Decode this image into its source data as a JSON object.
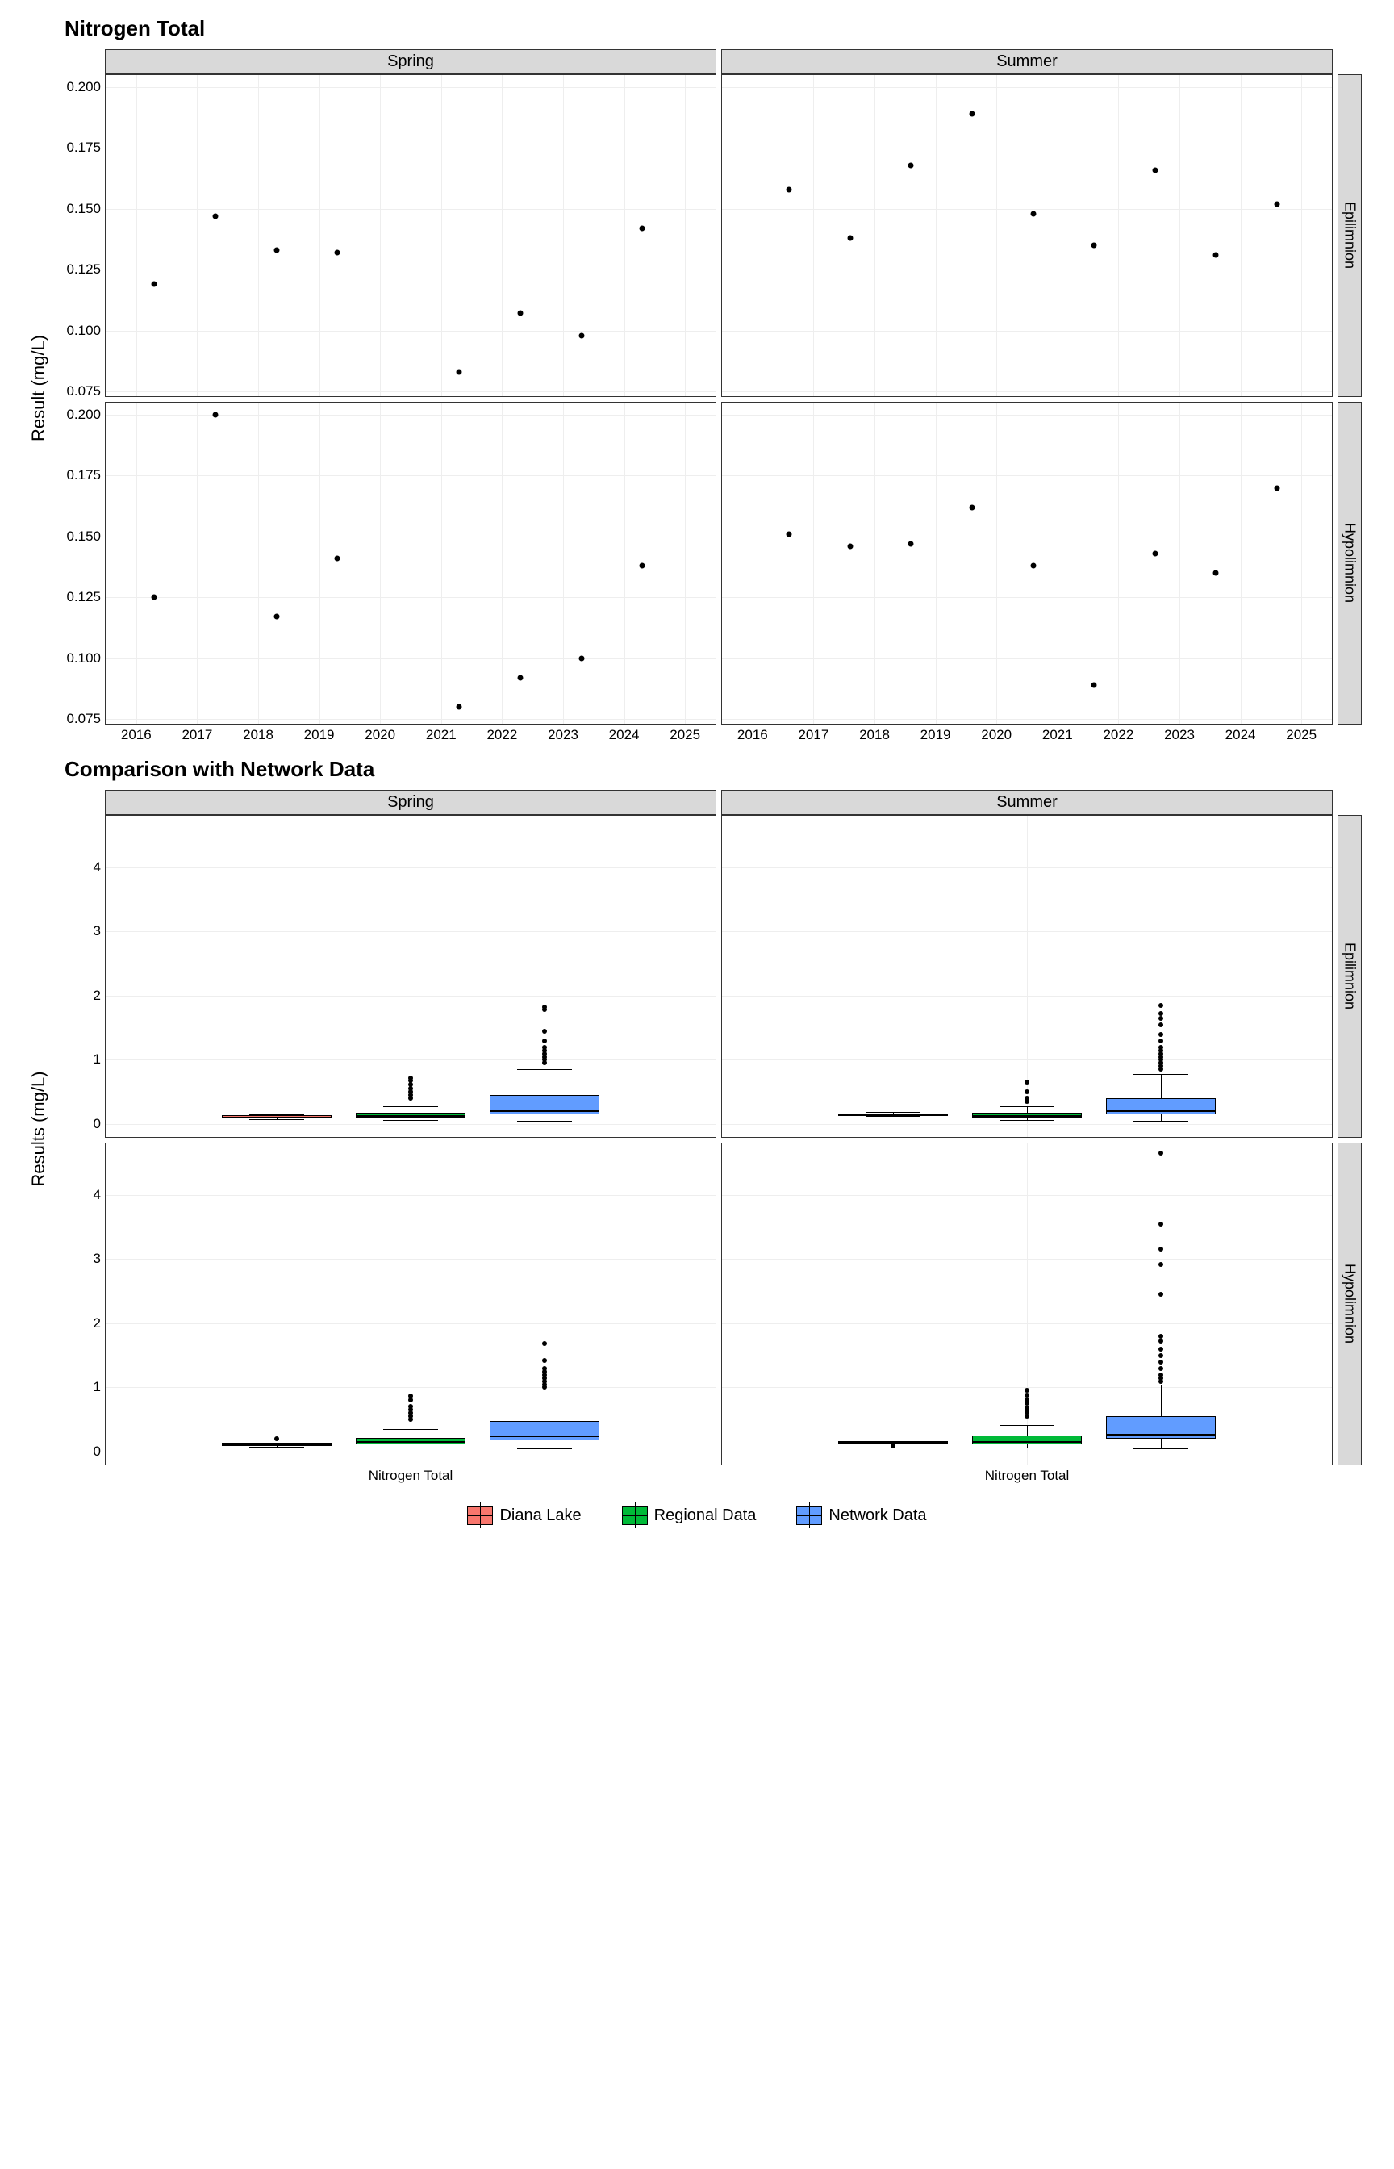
{
  "chart_data": [
    {
      "title": "Nitrogen Total",
      "type": "scatter",
      "ylabel": "Result (mg/L)",
      "xlabel": "",
      "col_facets": [
        "Spring",
        "Summer"
      ],
      "row_facets": [
        "Epilimnion",
        "Hypolimnion"
      ],
      "xlim": [
        2015.5,
        2025.5
      ],
      "ylim": [
        0.073,
        0.205
      ],
      "xticks": [
        2016,
        2017,
        2018,
        2019,
        2020,
        2021,
        2022,
        2023,
        2024,
        2025
      ],
      "yticks": [
        0.075,
        0.1,
        0.125,
        0.15,
        0.175,
        0.2
      ],
      "ytick_labels": [
        "0.075",
        "0.100",
        "0.125",
        "0.150",
        "0.175",
        "0.200"
      ],
      "panels": {
        "Spring|Epilimnion": [
          {
            "x": 2016.3,
            "y": 0.119
          },
          {
            "x": 2017.3,
            "y": 0.147
          },
          {
            "x": 2018.3,
            "y": 0.133
          },
          {
            "x": 2019.3,
            "y": 0.132
          },
          {
            "x": 2021.3,
            "y": 0.083
          },
          {
            "x": 2022.3,
            "y": 0.107
          },
          {
            "x": 2023.3,
            "y": 0.098
          },
          {
            "x": 2024.3,
            "y": 0.142
          }
        ],
        "Summer|Epilimnion": [
          {
            "x": 2016.6,
            "y": 0.158
          },
          {
            "x": 2017.6,
            "y": 0.138
          },
          {
            "x": 2018.6,
            "y": 0.168
          },
          {
            "x": 2019.6,
            "y": 0.189
          },
          {
            "x": 2020.6,
            "y": 0.148
          },
          {
            "x": 2021.6,
            "y": 0.135
          },
          {
            "x": 2022.6,
            "y": 0.166
          },
          {
            "x": 2023.6,
            "y": 0.131
          },
          {
            "x": 2024.6,
            "y": 0.152
          }
        ],
        "Spring|Hypolimnion": [
          {
            "x": 2016.3,
            "y": 0.125
          },
          {
            "x": 2017.3,
            "y": 0.2
          },
          {
            "x": 2018.3,
            "y": 0.117
          },
          {
            "x": 2019.3,
            "y": 0.141
          },
          {
            "x": 2021.3,
            "y": 0.08
          },
          {
            "x": 2022.3,
            "y": 0.092
          },
          {
            "x": 2023.3,
            "y": 0.1
          },
          {
            "x": 2024.3,
            "y": 0.138
          }
        ],
        "Summer|Hypolimnion": [
          {
            "x": 2016.6,
            "y": 0.151
          },
          {
            "x": 2017.6,
            "y": 0.146
          },
          {
            "x": 2018.6,
            "y": 0.147
          },
          {
            "x": 2019.6,
            "y": 0.162
          },
          {
            "x": 2020.6,
            "y": 0.138
          },
          {
            "x": 2021.6,
            "y": 0.089
          },
          {
            "x": 2022.6,
            "y": 0.143
          },
          {
            "x": 2023.6,
            "y": 0.135
          },
          {
            "x": 2024.6,
            "y": 0.17
          }
        ]
      }
    },
    {
      "title": "Comparison with Network Data",
      "type": "boxplot",
      "ylabel": "Results (mg/L)",
      "xlabel_cat": "Nitrogen Total",
      "col_facets": [
        "Spring",
        "Summer"
      ],
      "row_facets": [
        "Epilimnion",
        "Hypolimnion"
      ],
      "ylim": [
        -0.2,
        4.8
      ],
      "yticks": [
        0,
        1,
        2,
        3,
        4
      ],
      "series": [
        "Diana Lake",
        "Regional Data",
        "Network Data"
      ],
      "colors": {
        "Diana Lake": "#F8766D",
        "Regional Data": "#00BA38",
        "Network Data": "#619CFF"
      },
      "panels": {
        "Spring|Epilimnion": {
          "Diana Lake": {
            "min": 0.08,
            "q1": 0.1,
            "med": 0.12,
            "q3": 0.14,
            "max": 0.15,
            "outliers": []
          },
          "Regional Data": {
            "min": 0.06,
            "q1": 0.1,
            "med": 0.14,
            "q3": 0.18,
            "max": 0.28,
            "outliers": [
              0.4,
              0.45,
              0.5,
              0.55,
              0.62,
              0.68,
              0.72
            ]
          },
          "Network Data": {
            "min": 0.05,
            "q1": 0.15,
            "med": 0.22,
            "q3": 0.45,
            "max": 0.85,
            "outliers": [
              0.95,
              1.0,
              1.05,
              1.1,
              1.15,
              1.2,
              1.3,
              1.45,
              1.78,
              1.82
            ]
          }
        },
        "Summer|Epilimnion": {
          "Diana Lake": {
            "min": 0.13,
            "q1": 0.14,
            "med": 0.15,
            "q3": 0.17,
            "max": 0.19,
            "outliers": []
          },
          "Regional Data": {
            "min": 0.06,
            "q1": 0.1,
            "med": 0.14,
            "q3": 0.18,
            "max": 0.28,
            "outliers": [
              0.35,
              0.4,
              0.5,
              0.65
            ]
          },
          "Network Data": {
            "min": 0.05,
            "q1": 0.15,
            "med": 0.22,
            "q3": 0.4,
            "max": 0.78,
            "outliers": [
              0.85,
              0.9,
              0.95,
              1.0,
              1.05,
              1.1,
              1.15,
              1.2,
              1.3,
              1.4,
              1.55,
              1.65,
              1.72,
              1.85
            ]
          }
        },
        "Spring|Hypolimnion": {
          "Diana Lake": {
            "min": 0.08,
            "q1": 0.1,
            "med": 0.12,
            "q3": 0.14,
            "max": 0.14,
            "outliers": [
              0.2
            ]
          },
          "Regional Data": {
            "min": 0.06,
            "q1": 0.12,
            "med": 0.16,
            "q3": 0.22,
            "max": 0.35,
            "outliers": [
              0.5,
              0.55,
              0.6,
              0.65,
              0.7,
              0.8,
              0.87
            ]
          },
          "Network Data": {
            "min": 0.05,
            "q1": 0.18,
            "med": 0.25,
            "q3": 0.48,
            "max": 0.9,
            "outliers": [
              1.0,
              1.05,
              1.1,
              1.15,
              1.2,
              1.25,
              1.3,
              1.42,
              1.68
            ]
          }
        },
        "Summer|Hypolimnion": {
          "Diana Lake": {
            "min": 0.13,
            "q1": 0.14,
            "med": 0.15,
            "q3": 0.16,
            "max": 0.17,
            "outliers": [
              0.09
            ]
          },
          "Regional Data": {
            "min": 0.06,
            "q1": 0.12,
            "med": 0.17,
            "q3": 0.25,
            "max": 0.42,
            "outliers": [
              0.55,
              0.62,
              0.68,
              0.75,
              0.8,
              0.88,
              0.95
            ]
          },
          "Network Data": {
            "min": 0.05,
            "q1": 0.2,
            "med": 0.28,
            "q3": 0.55,
            "max": 1.05,
            "outliers": [
              1.1,
              1.15,
              1.2,
              1.3,
              1.4,
              1.5,
              1.6,
              1.72,
              1.8,
              2.45,
              2.92,
              3.15,
              3.55,
              4.65
            ]
          }
        }
      }
    }
  ],
  "legend": {
    "items": [
      {
        "label": "Diana Lake",
        "color": "#F8766D"
      },
      {
        "label": "Regional Data",
        "color": "#00BA38"
      },
      {
        "label": "Network Data",
        "color": "#619CFF"
      }
    ]
  }
}
